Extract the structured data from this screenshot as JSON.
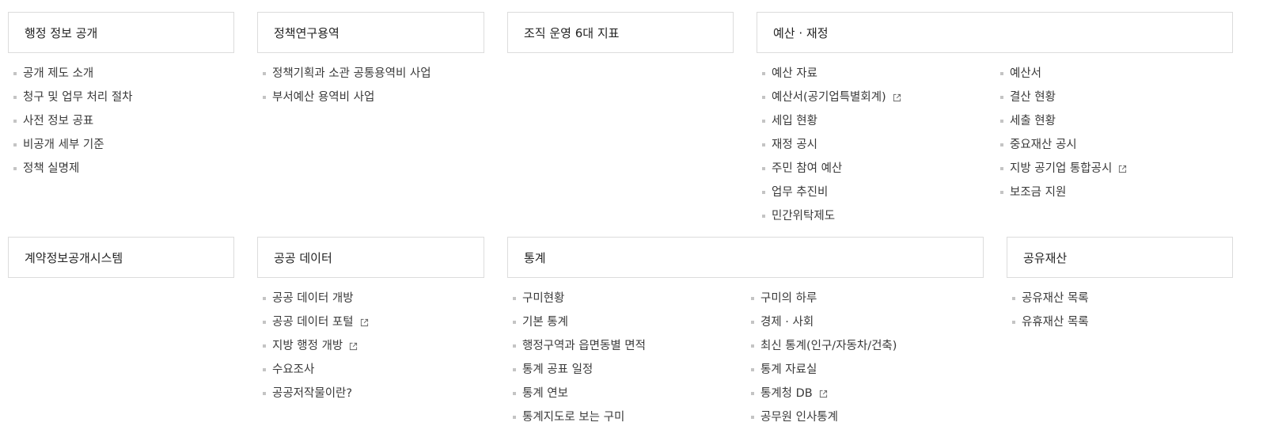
{
  "sections": {
    "admin_info": {
      "title": "행정 정보 공개",
      "items": [
        "공개 제도 소개",
        "청구 및 업무 처리 절차",
        "사전 정보 공표",
        "비공개 세부 기준",
        "정책 실명제"
      ]
    },
    "policy_research": {
      "title": "정책연구용역",
      "items": [
        "정책기획과 소관 공통용역비 사업",
        "부서예산 용역비 사업"
      ]
    },
    "org_indicators": {
      "title": "조직 운영 6대 지표"
    },
    "budget": {
      "title": "예산 · 재정",
      "col1": [
        "예산 자료",
        "예산서(공기업특별회계)",
        "세입 현황",
        "재정 공시",
        "주민 참여 예산",
        "업무 추진비",
        "민간위탁제도"
      ],
      "col2": [
        "예산서",
        "결산 현황",
        "세출 현황",
        "중요재산 공시",
        "지방 공기업 통합공시",
        "보조금 지원"
      ]
    },
    "contract": {
      "title": "계약정보공개시스템"
    },
    "public_data": {
      "title": "공공 데이터",
      "items": [
        "공공 데이터 개방",
        "공공 데이터 포털",
        "지방 행정 개방",
        "수요조사",
        "공공저작물이란?"
      ]
    },
    "statistics": {
      "title": "통계",
      "col1": [
        "구미현황",
        "기본 통계",
        "행정구역과 읍면동별 면적",
        "통계 공표 일정",
        "통계 연보",
        "통계지도로 보는 구미"
      ],
      "col2": [
        "구미의 하루",
        "경제 · 사회",
        "최신 통계(인구/자동차/건축)",
        "통계 자료실",
        "통계청 DB",
        "공무원 인사통계"
      ]
    },
    "public_property": {
      "title": "공유재산",
      "items": [
        "공유재산 목록",
        "유휴재산 목록"
      ]
    }
  },
  "colors": {
    "border": "#dcdcdc",
    "bullet": "#c4c4c4",
    "text": "#3a3a3a",
    "title": "#222222"
  },
  "icons": {
    "external_link": "external-link-icon"
  }
}
